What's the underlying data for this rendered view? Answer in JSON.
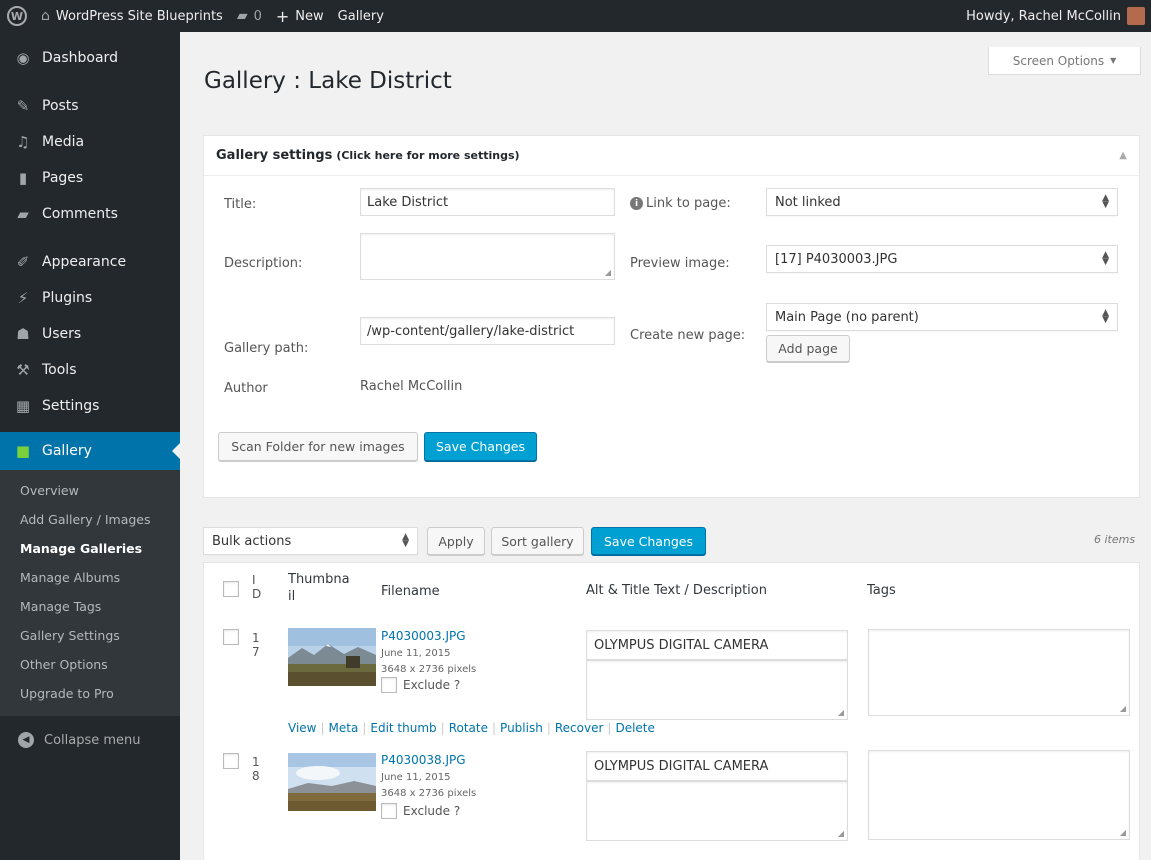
{
  "adminbar": {
    "site_name": "WordPress Site Blueprints",
    "comments_count": "0",
    "new_label": "New",
    "gallery_label": "Gallery",
    "howdy": "Howdy, Rachel McCollin"
  },
  "sidebar": {
    "items": [
      {
        "label": "Dashboard",
        "icon": "dashboard-icon"
      },
      {
        "label": "Posts",
        "icon": "pin-icon"
      },
      {
        "label": "Media",
        "icon": "media-icon"
      },
      {
        "label": "Pages",
        "icon": "pages-icon"
      },
      {
        "label": "Comments",
        "icon": "comments-icon"
      },
      {
        "label": "Appearance",
        "icon": "brush-icon"
      },
      {
        "label": "Plugins",
        "icon": "plugin-icon"
      },
      {
        "label": "Users",
        "icon": "users-icon"
      },
      {
        "label": "Tools",
        "icon": "wrench-icon"
      },
      {
        "label": "Settings",
        "icon": "settings-icon"
      }
    ],
    "current": {
      "label": "Gallery",
      "icon": "gallery-icon"
    },
    "submenu": [
      "Overview",
      "Add Gallery / Images",
      "Manage Galleries",
      "Manage Albums",
      "Manage Tags",
      "Gallery Settings",
      "Other Options",
      "Upgrade to Pro"
    ],
    "submenu_active": "Manage Galleries",
    "collapse": "Collapse menu"
  },
  "screen_options": "Screen Options",
  "page_title": "Gallery : Lake District",
  "settings": {
    "heading": "Gallery settings",
    "heading_note": "(Click here for more settings)",
    "title_label": "Title:",
    "title_value": "Lake District",
    "description_label": "Description:",
    "description_value": "",
    "path_label": "Gallery path:",
    "path_value": "/wp-content/gallery/lake-district",
    "author_label": "Author",
    "author_value": "Rachel McCollin",
    "link_label": "Link to page:",
    "link_value": "Not linked",
    "preview_label": "Preview image:",
    "preview_value": "[17] P4030003.JPG",
    "create_label": "Create new page:",
    "create_value": "Main Page (no parent)",
    "add_page": "Add page",
    "scan_button": "Scan Folder for new images",
    "save_button": "Save Changes"
  },
  "toolbar": {
    "bulk_actions": "Bulk actions",
    "apply": "Apply",
    "sort": "Sort gallery",
    "save": "Save Changes",
    "items_count": "6 items"
  },
  "table": {
    "headers": {
      "id": "ID",
      "thumbnail": "Thumbnail",
      "filename": "Filename",
      "alt": "Alt & Title Text / Description",
      "tags": "Tags"
    },
    "rows": [
      {
        "id": "17",
        "filename": "P4030003.JPG",
        "date": "June 11, 2015",
        "size": "3648 x 2736 pixels",
        "exclude": "Exclude ?",
        "alt": "OLYMPUS DIGITAL CAMERA",
        "actions": [
          "View",
          "Meta",
          "Edit thumb",
          "Rotate",
          "Publish",
          "Recover",
          "Delete"
        ]
      },
      {
        "id": "18",
        "filename": "P4030038.JPG",
        "date": "June 11, 2015",
        "size": "3648 x 2736 pixels",
        "exclude": "Exclude ?",
        "alt": "OLYMPUS DIGITAL CAMERA"
      }
    ]
  }
}
